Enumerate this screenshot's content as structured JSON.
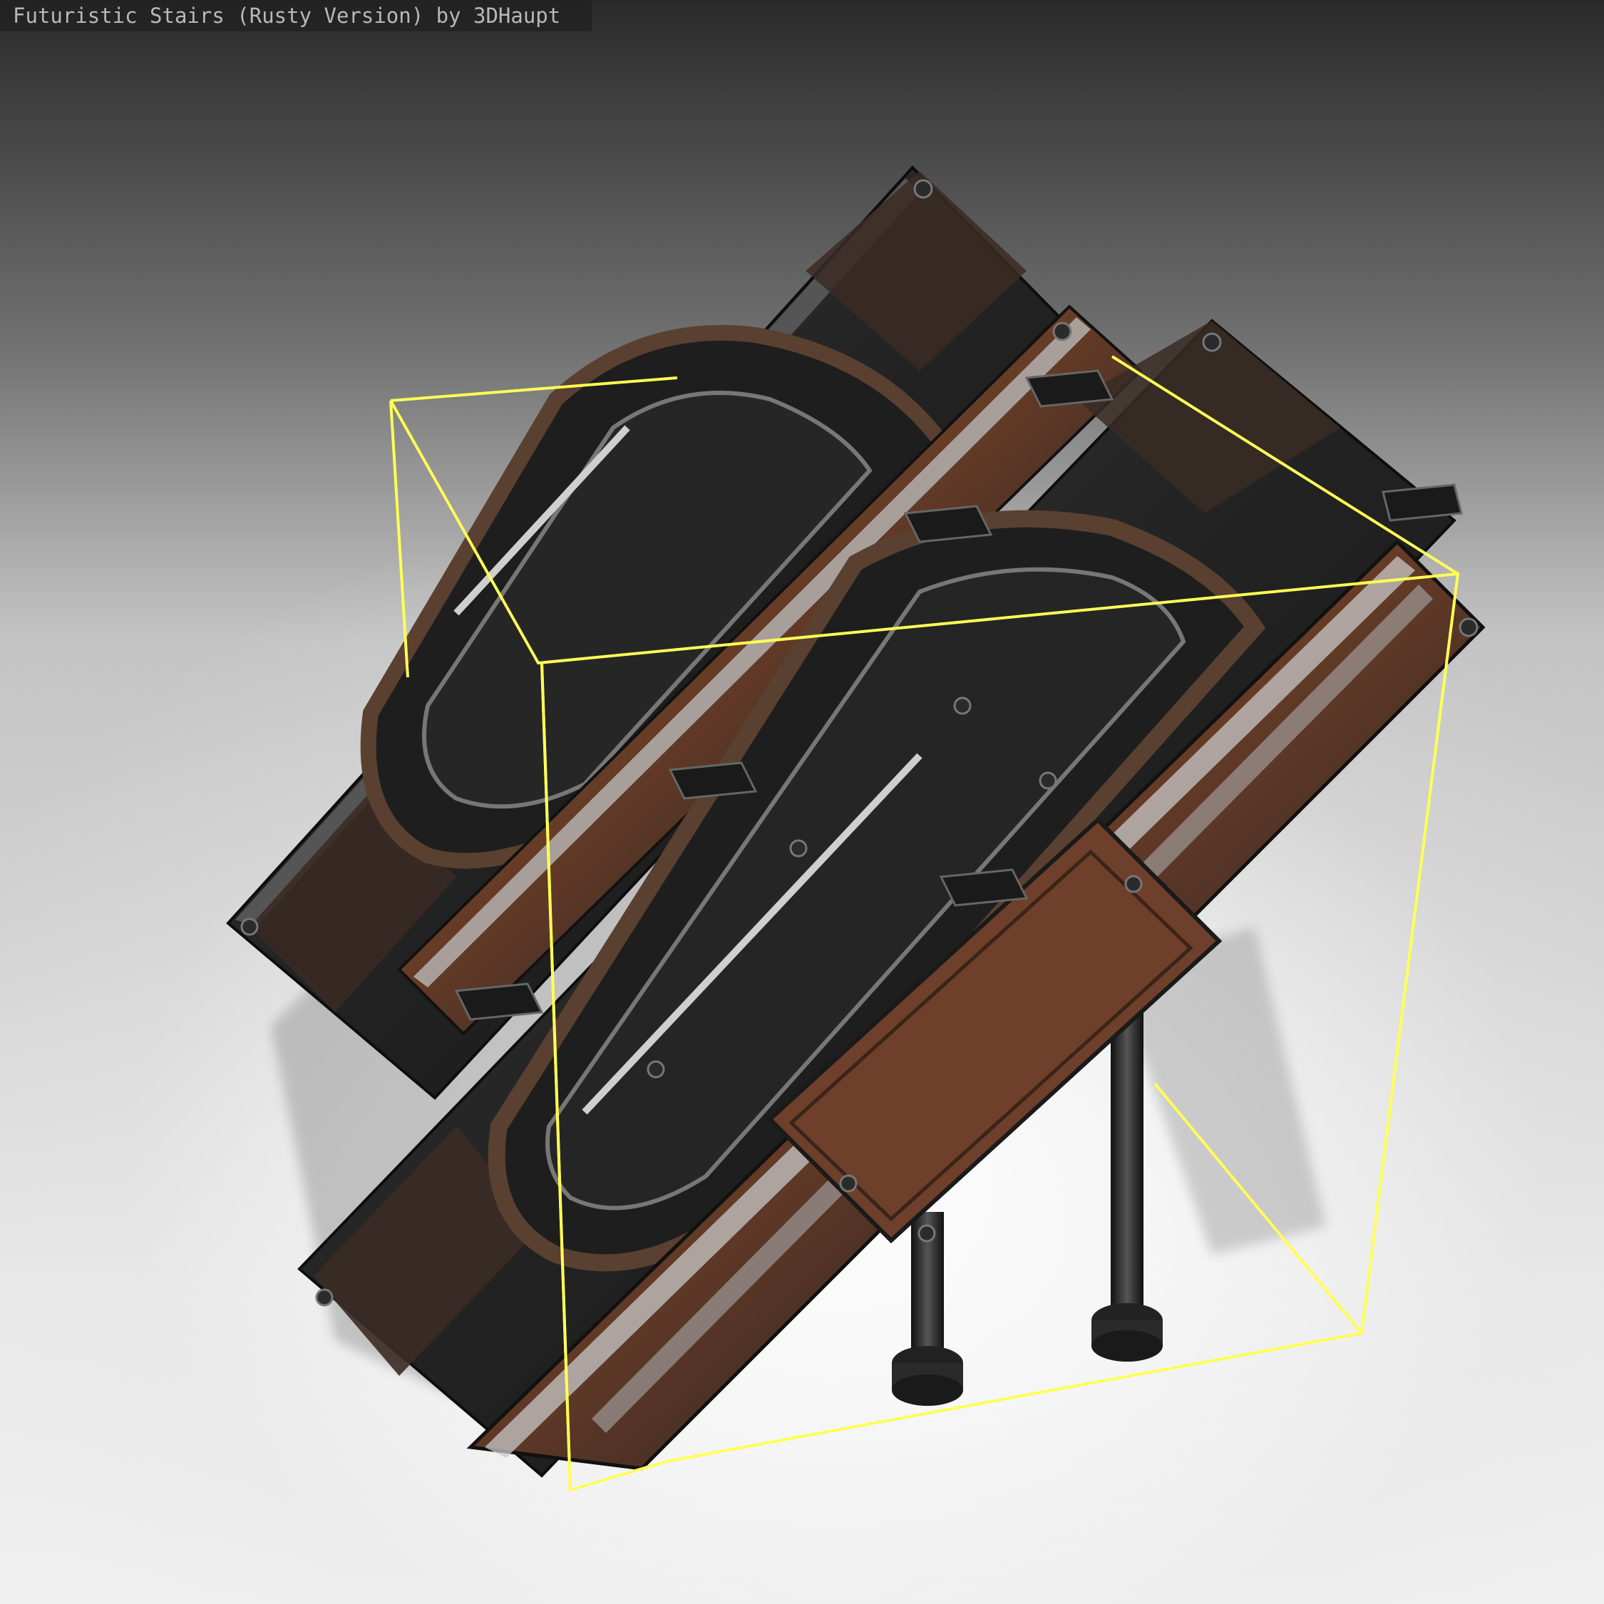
{
  "viewer": {
    "title": "Futuristic Stairs (Rusty Version) by 3DHaupt"
  },
  "scene": {
    "model": "futuristic-stairs-rusty",
    "selection_outline_color": "#ffff55",
    "rust_color": "#8e4a2a",
    "metal_color": "#2a2a2a",
    "background_top_color": "#2a2a2a",
    "background_bottom_color": "#f0f0f0"
  }
}
